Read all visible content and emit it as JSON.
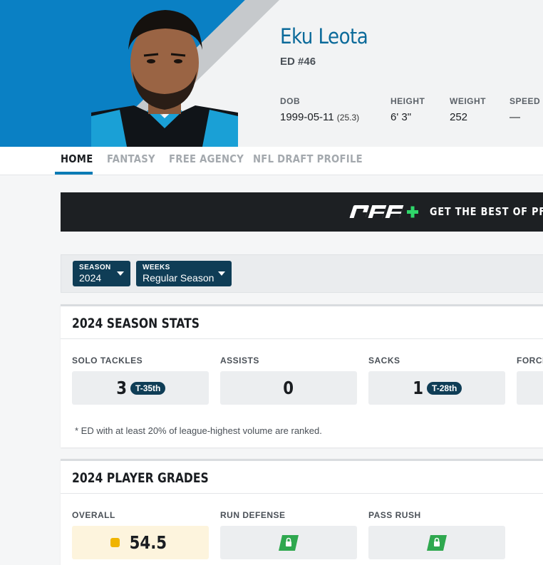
{
  "player": {
    "name": "Eku Leota",
    "position": "ED #46",
    "bio": [
      {
        "label": "DOB",
        "value": "1999-05-11",
        "extra": "(25.3)"
      },
      {
        "label": "HEIGHT",
        "value": "6' 3\"",
        "extra": ""
      },
      {
        "label": "WEIGHT",
        "value": "252",
        "extra": ""
      },
      {
        "label": "SPEED",
        "value": "—",
        "extra": ""
      }
    ]
  },
  "tabs": [
    "HOME",
    "FANTASY",
    "FREE AGENCY",
    "NFL DRAFT PROFILE"
  ],
  "banner": {
    "logo": "PFF+",
    "text": "GET THE BEST OF PFF"
  },
  "filters": {
    "season": {
      "label": "SEASON",
      "value": "2024"
    },
    "weeks": {
      "label": "WEEKS",
      "value": "Regular Season"
    }
  },
  "season_stats": {
    "title": "2024 SEASON STATS",
    "stats": [
      {
        "label": "SOLO TACKLES",
        "value": "3",
        "rank": "T-35th"
      },
      {
        "label": "ASSISTS",
        "value": "0",
        "rank": ""
      },
      {
        "label": "SACKS",
        "value": "1",
        "rank": "T-28th"
      },
      {
        "label": "FORCE",
        "value": "",
        "rank": ""
      }
    ],
    "footnote": "* ED with at least 20% of league-highest volume are ranked."
  },
  "player_grades": {
    "title": "2024 PLAYER GRADES",
    "grades": [
      {
        "label": "OVERALL",
        "value": "54.5",
        "locked": false
      },
      {
        "label": "RUN DEFENSE",
        "value": "",
        "locked": true
      },
      {
        "label": "PASS RUSH",
        "value": "",
        "locked": true
      }
    ]
  },
  "colors": {
    "accent": "#0b7bb5",
    "hero_blue": "#0a80c4",
    "dropdown": "#0f3d56",
    "lock_green": "#2fa84f",
    "grade_yellow": "#f0b400"
  }
}
